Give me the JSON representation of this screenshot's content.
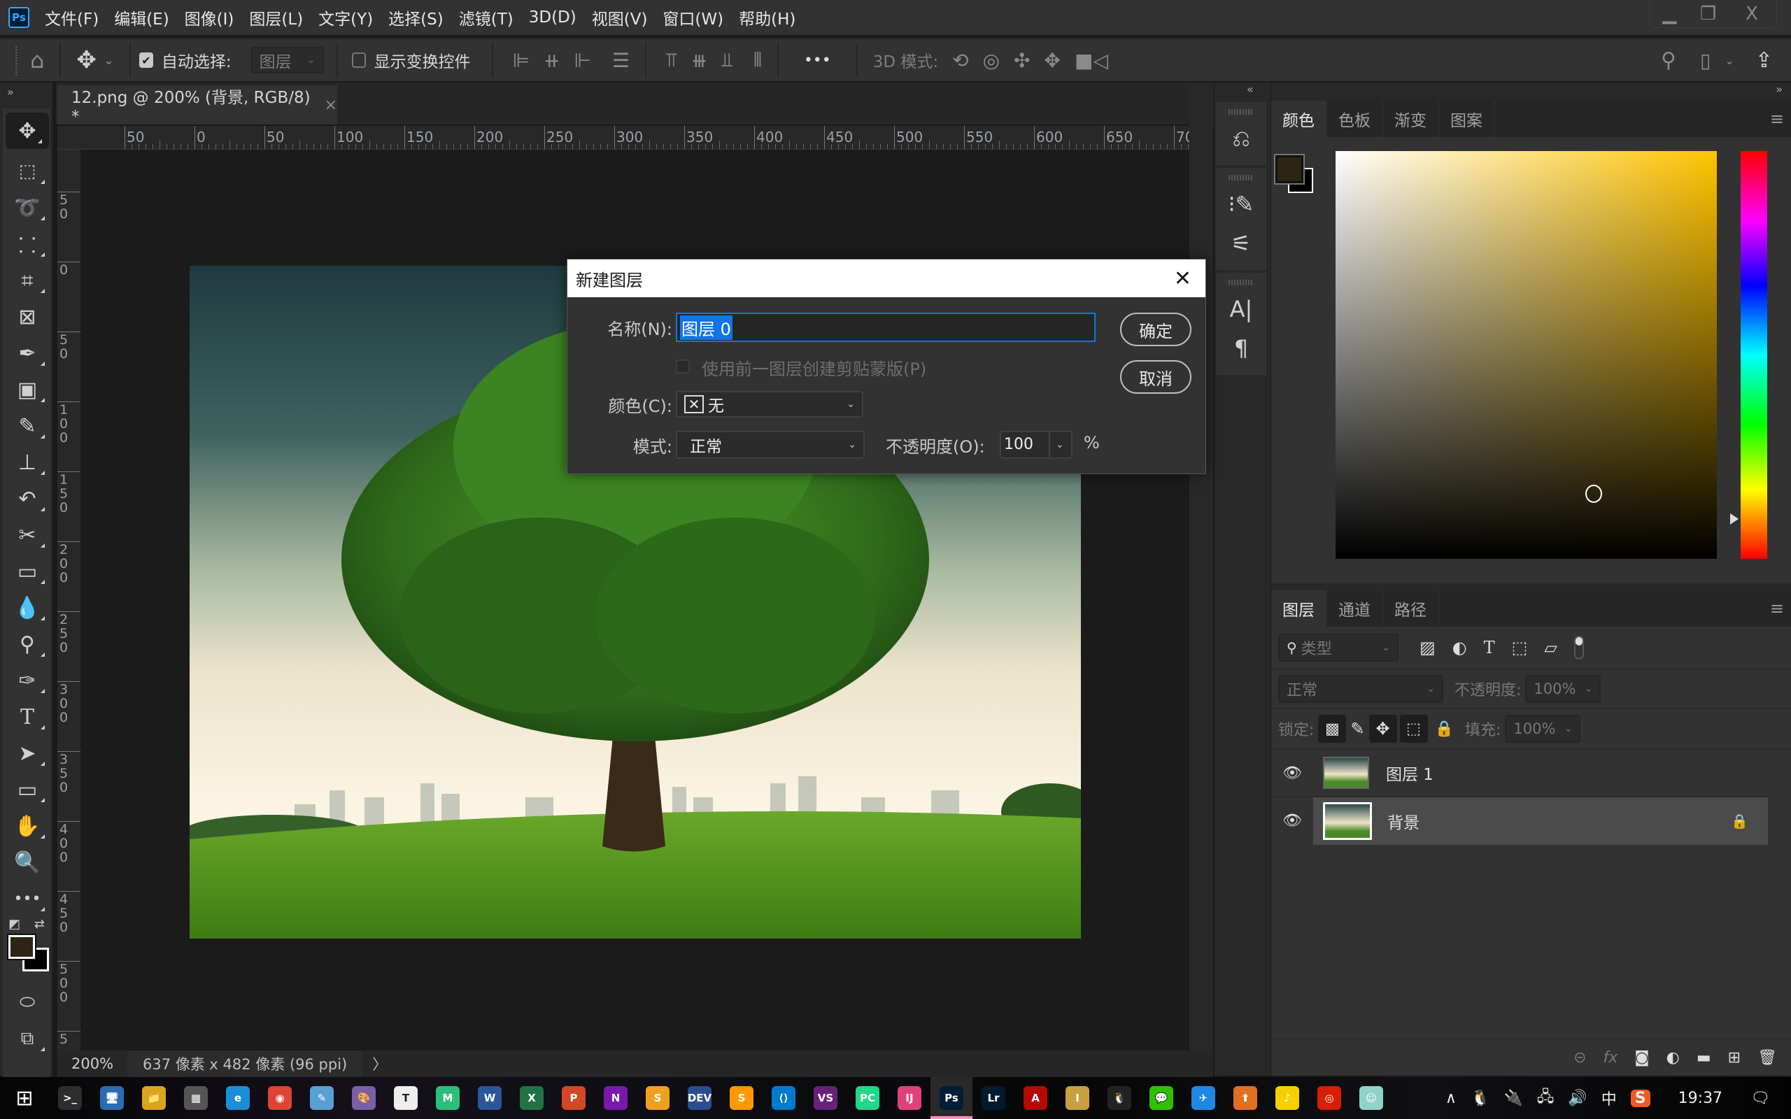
{
  "menubar": {
    "logo": "Ps",
    "items": [
      "文件(F)",
      "编辑(E)",
      "图像(I)",
      "图层(L)",
      "文字(Y)",
      "选择(S)",
      "滤镜(T)",
      "3D(D)",
      "视图(V)",
      "窗口(W)",
      "帮助(H)"
    ],
    "window_controls": {
      "minimize": "▁",
      "restore": "❐",
      "close": "X"
    }
  },
  "options": {
    "auto_select_label": "自动选择:",
    "auto_select_checked": true,
    "auto_select_target": "图层",
    "show_transform_label": "显示变换控件",
    "show_transform_checked": false,
    "more": "•••",
    "mode_3d_label": "3D 模式:"
  },
  "document": {
    "tab_title": "12.png @ 200% (背景, RGB/8) *",
    "ruler_top_labels": [
      "50",
      "0",
      "50",
      "100",
      "150",
      "200",
      "250",
      "300",
      "350",
      "400",
      "450",
      "500",
      "550",
      "600",
      "650",
      "70"
    ],
    "ruler_left_labels": [
      "0",
      "5 0",
      "0",
      "5 0",
      "1 0 0",
      "1 5 0",
      "2 0 0",
      "2 5 0",
      "3 0 0",
      "3 5 0",
      "4 0 0",
      "4 5 0",
      "5 0 0",
      "5"
    ]
  },
  "status": {
    "zoom": "200%",
    "info": "637 像素 x 482 像素 (96 ppi)",
    "arrow": "〉"
  },
  "dialog": {
    "title": "新建图层",
    "name_label": "名称(N):",
    "name_value": "图层 0",
    "clip_label": "使用前一图层创建剪贴蒙版(P)",
    "clip_checked": false,
    "color_label": "颜色(C):",
    "color_value": "无",
    "mode_label": "模式:",
    "mode_value": "正常",
    "opacity_label": "不透明度(O):",
    "opacity_value": "100",
    "opacity_unit": "%",
    "ok": "确定",
    "cancel": "取消"
  },
  "color_panel": {
    "tabs": [
      "颜色",
      "色板",
      "渐变",
      "图案"
    ],
    "active_tab": 0,
    "foreground": "#2d2414",
    "background": "#000000",
    "hue_color": "#ffc400"
  },
  "layers_panel": {
    "tabs": [
      "图层",
      "通道",
      "路径"
    ],
    "active_tab": 0,
    "filter_placeholder": "类型",
    "blend_mode": "正常",
    "opacity_label": "不透明度:",
    "opacity_value": "100%",
    "lock_label": "锁定:",
    "fill_label": "填充:",
    "fill_value": "100%",
    "layers": [
      {
        "name": "图层 1",
        "visible": true,
        "locked": false,
        "selected": false
      },
      {
        "name": "背景",
        "visible": true,
        "locked": true,
        "selected": true
      }
    ]
  },
  "taskbar": {
    "apps": [
      {
        "name": "terminal",
        "label": ">_",
        "color": "#2d2d2d"
      },
      {
        "name": "remote-desktop",
        "label": "🖥",
        "color": "#2b6cb0"
      },
      {
        "name": "file-explorer",
        "label": "📁",
        "color": "#d9a520"
      },
      {
        "name": "calculator",
        "label": "▦",
        "color": "#555"
      },
      {
        "name": "edge",
        "label": "e",
        "color": "#1a8fd8"
      },
      {
        "name": "chrome",
        "label": "◉",
        "color": "#db4437"
      },
      {
        "name": "notepad",
        "label": "✎",
        "color": "#5a9fd4"
      },
      {
        "name": "paint",
        "label": "🎨",
        "color": "#7a5fa8"
      },
      {
        "name": "typora",
        "label": "T",
        "color": "#eee"
      },
      {
        "name": "xmind",
        "label": "M",
        "color": "#2dbf7a"
      },
      {
        "name": "word",
        "label": "W",
        "color": "#2b579a"
      },
      {
        "name": "excel",
        "label": "X",
        "color": "#217346"
      },
      {
        "name": "powerpoint",
        "label": "P",
        "color": "#d24726"
      },
      {
        "name": "onenote",
        "label": "N",
        "color": "#7719aa"
      },
      {
        "name": "notes",
        "label": "S",
        "color": "#f0a020"
      },
      {
        "name": "dev-cpp",
        "label": "DEV",
        "color": "#2a4d8f"
      },
      {
        "name": "sublime",
        "label": "S",
        "color": "#ff9800"
      },
      {
        "name": "vscode",
        "label": "⟨⟩",
        "color": "#007acc"
      },
      {
        "name": "visual-studio",
        "label": "VS",
        "color": "#68217a"
      },
      {
        "name": "pycharm",
        "label": "PC",
        "color": "#21d789"
      },
      {
        "name": "intellij",
        "label": "IJ",
        "color": "#e0407b"
      },
      {
        "name": "photoshop",
        "label": "Ps",
        "color": "#001e36",
        "active": true
      },
      {
        "name": "lightroom",
        "label": "Lr",
        "color": "#001a2e"
      },
      {
        "name": "acrobat",
        "label": "A",
        "color": "#b30b00"
      },
      {
        "name": "dictionary",
        "label": "I",
        "color": "#c8a040"
      },
      {
        "name": "qq",
        "label": "🐧",
        "color": "#222"
      },
      {
        "name": "wechat",
        "label": "💬",
        "color": "#2dc100"
      },
      {
        "name": "feishu",
        "label": "✈",
        "color": "#1e88e5"
      },
      {
        "name": "app-orange",
        "label": "⬆",
        "color": "#e07020"
      },
      {
        "name": "qq-music",
        "label": "♪",
        "color": "#f5d000"
      },
      {
        "name": "netease-music",
        "label": "◎",
        "color": "#d81e06"
      },
      {
        "name": "anime-app",
        "label": "☺",
        "color": "#8fd3c8"
      }
    ],
    "tray": {
      "chevron": "∧",
      "ime": "中",
      "clock": "19:37"
    }
  }
}
